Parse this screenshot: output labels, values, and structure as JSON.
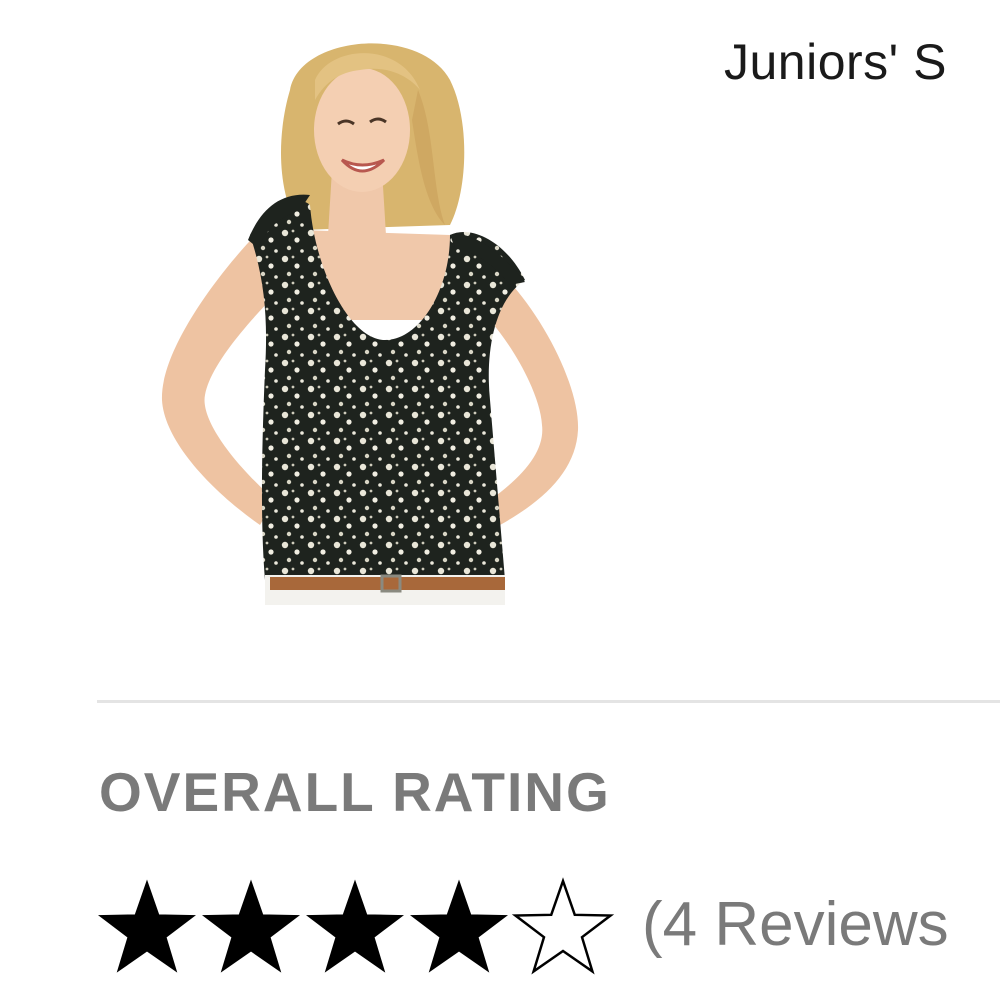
{
  "product": {
    "title": "Juniors' S",
    "image_alt": "Juniors' floral tie-shoulder tank top"
  },
  "rating": {
    "heading": "OVERALL RATING",
    "value": 4,
    "max": 5,
    "review_count_text": "(4 Reviews",
    "star_color": "#000000"
  },
  "colors": {
    "heading": "#7a7a7a",
    "divider": "#e4e4e4",
    "title": "#1a1a1a"
  }
}
